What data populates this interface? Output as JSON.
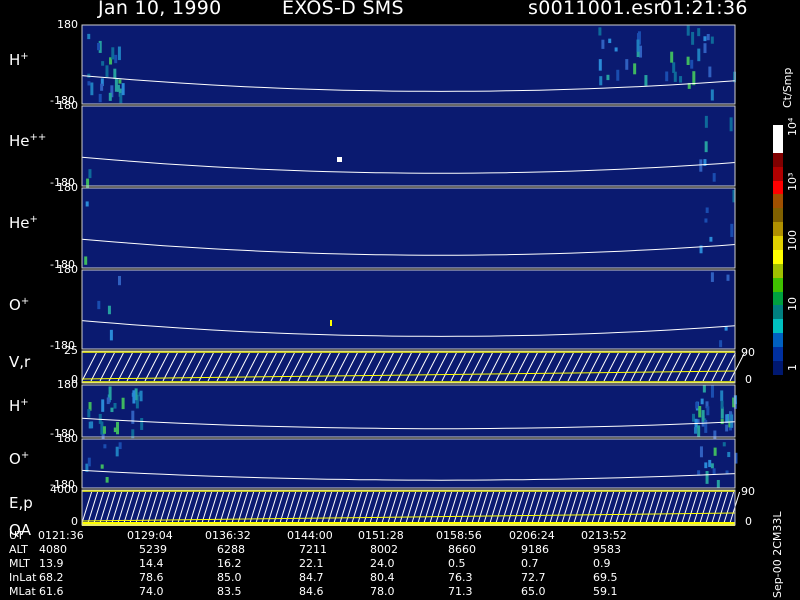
{
  "header": {
    "date": "Jan 10, 1990",
    "instrument": "EXOS-D SMS",
    "file": "s0011001.esr",
    "time": "01:21:36"
  },
  "colors": {
    "background": "#000000",
    "panel_fill": "#0a1a70",
    "trace": "#ffffff",
    "highlight": "#ffff00"
  },
  "colorbar": {
    "unit_label": "Ct/Smp",
    "tick_labels": [
      "10⁴",
      "10³",
      "100",
      "10",
      "1"
    ],
    "stops": [
      "#ffffff",
      "#ffffff",
      "#800000",
      "#b00000",
      "#ff0000",
      "#a05000",
      "#806000",
      "#b09000",
      "#e0d000",
      "#ffff00",
      "#a0c000",
      "#40c000",
      "#00a040",
      "#008080",
      "#00c0c0",
      "#0060c0",
      "#0030a0",
      "#001870"
    ]
  },
  "footer_note": "Sep-00 2CM33L",
  "chart_data": {
    "type": "heatmap",
    "time_ticks": [
      "0121:36",
      "0129:04",
      "0136:32",
      "0144:00",
      "0151:28",
      "0158:56",
      "0206:24",
      "0213:52"
    ],
    "panels": [
      {
        "label": "H",
        "charge": "+",
        "ylim_top": "180",
        "ylim_bottom": "-180"
      },
      {
        "label": "He",
        "charge": "++",
        "ylim_top": "180",
        "ylim_bottom": "-180"
      },
      {
        "label": "He",
        "charge": "+",
        "ylim_top": "180",
        "ylim_bottom": "-180"
      },
      {
        "label": "O",
        "charge": "+",
        "ylim_top": "180",
        "ylim_bottom": "-180"
      },
      {
        "label": "V,r",
        "charge": "",
        "ylim_top": "25",
        "ylim_bottom": "0",
        "right_top": "90",
        "right_bottom": "0"
      },
      {
        "label": "H",
        "charge": "+",
        "ylim_top": "180",
        "ylim_bottom": "-180"
      },
      {
        "label": "O",
        "charge": "+",
        "ylim_top": "180",
        "ylim_bottom": "-180"
      },
      {
        "label": "E,p",
        "label2": "QA",
        "charge": "",
        "ylim_top": "4000",
        "ylim_bottom": "0",
        "right_top": "90",
        "right_bottom": "0"
      }
    ],
    "ephemeris": [
      {
        "name": "UT",
        "values": [
          "0121:36",
          "0129:04",
          "0136:32",
          "0144:00",
          "0151:28",
          "0158:56",
          "0206:24",
          "0213:52"
        ]
      },
      {
        "name": "ALT",
        "values": [
          "4080",
          "5239",
          "6288",
          "7211",
          "8002",
          "8660",
          "9186",
          "9583"
        ]
      },
      {
        "name": "MLT",
        "values": [
          "13.9",
          "14.4",
          "16.2",
          "22.1",
          "24.0",
          "0.5",
          "0.7",
          "0.9"
        ]
      },
      {
        "name": "InLat",
        "values": [
          "68.2",
          "78.6",
          "85.0",
          "84.7",
          "80.4",
          "76.3",
          "72.7",
          "69.5"
        ]
      },
      {
        "name": "MLat",
        "values": [
          "61.6",
          "74.0",
          "83.5",
          "84.6",
          "78.0",
          "71.3",
          "65.0",
          "59.1"
        ]
      }
    ]
  }
}
